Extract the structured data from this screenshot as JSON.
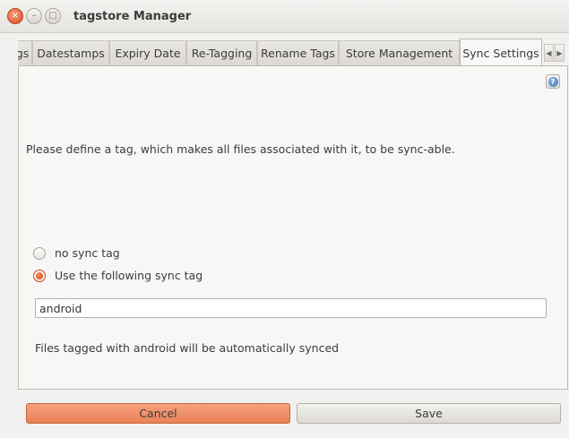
{
  "window": {
    "title": "tagstore Manager",
    "close_glyph": "×",
    "min_glyph": "–",
    "max_glyph": "□"
  },
  "tabs": [
    {
      "label": "gs"
    },
    {
      "label": "Datestamps"
    },
    {
      "label": "Expiry Date"
    },
    {
      "label": "Re-Tagging"
    },
    {
      "label": "Rename Tags"
    },
    {
      "label": "Store Management"
    },
    {
      "label": "Sync Settings",
      "active": true
    }
  ],
  "tab_nav": {
    "left_glyph": "◀",
    "right_glyph": "▶"
  },
  "panel": {
    "help_glyph": "?",
    "description": "Please define a tag, which makes all files associated with it, to be sync-able.",
    "radio_options": [
      {
        "label": "no sync tag",
        "checked": false
      },
      {
        "label": "Use the following sync tag",
        "checked": true
      }
    ],
    "sync_tag_value": "android",
    "sync_info": "Files tagged with android will be automatically synced"
  },
  "buttons": {
    "cancel": "Cancel",
    "save": "Save"
  },
  "colors": {
    "accent": "#dd4814",
    "cancel_bg": "#ef8d64",
    "window_bg": "#f2f1f0"
  }
}
